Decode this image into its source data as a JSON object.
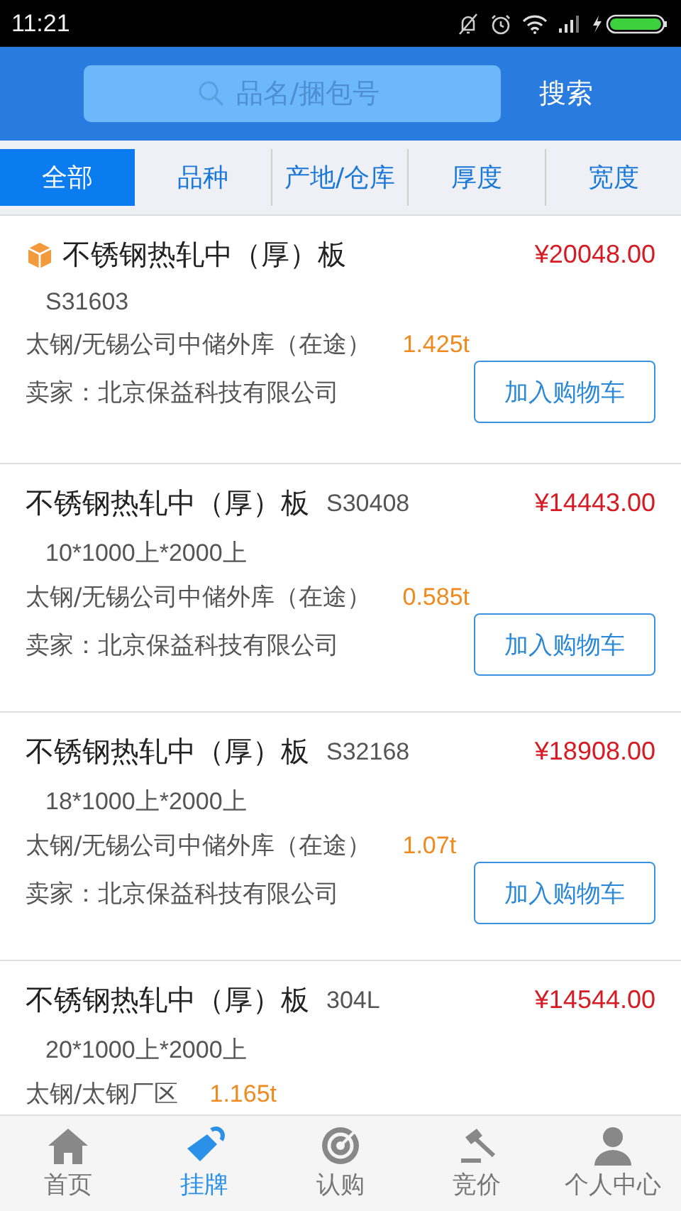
{
  "status_bar": {
    "time": "11:21"
  },
  "search": {
    "placeholder": "品名/捆包号",
    "button": "搜索"
  },
  "filters": [
    {
      "label": "全部",
      "selected": true
    },
    {
      "label": "品种",
      "selected": false
    },
    {
      "label": "产地/仓库",
      "selected": false
    },
    {
      "label": "厚度",
      "selected": false
    },
    {
      "label": "宽度",
      "selected": false
    }
  ],
  "listings": [
    {
      "featured": true,
      "name": "不锈钢热轧中（厚）板",
      "price": "¥20048.00",
      "spec": "S31603",
      "location": "太钢/无锡公司中储外库（在途）",
      "weight": "1.425t",
      "seller": "卖家：北京保益科技有限公司",
      "button": "加入购物车"
    },
    {
      "featured": false,
      "name": "不锈钢热轧中（厚）板",
      "grade": "S30408",
      "price": "¥14443.00",
      "spec": "10*1000上*2000上",
      "location": "太钢/无锡公司中储外库（在途）",
      "weight": "0.585t",
      "seller": "卖家：北京保益科技有限公司",
      "button": "加入购物车"
    },
    {
      "featured": false,
      "name": "不锈钢热轧中（厚）板",
      "grade": "S32168",
      "price": "¥18908.00",
      "spec": "18*1000上*2000上",
      "location": "太钢/无锡公司中储外库（在途）",
      "weight": "1.07t",
      "seller": "卖家：北京保益科技有限公司",
      "button": "加入购物车"
    },
    {
      "featured": false,
      "name": "不锈钢热轧中（厚）板",
      "grade": "304L",
      "price": "¥14544.00",
      "spec": "20*1000上*2000上",
      "location": "太钢/太钢厂区",
      "weight": "1.165t"
    }
  ],
  "nav": [
    {
      "kind": "home",
      "label": "首页",
      "selected": false
    },
    {
      "kind": "tag",
      "label": "挂牌",
      "selected": true
    },
    {
      "kind": "target",
      "label": "认购",
      "selected": false
    },
    {
      "kind": "gavel",
      "label": "竞价",
      "selected": false
    },
    {
      "kind": "person",
      "label": "个人中心",
      "selected": false
    }
  ]
}
